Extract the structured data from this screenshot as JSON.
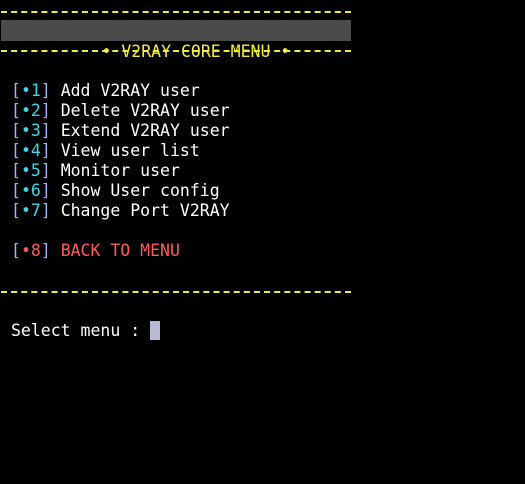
{
  "header": {
    "title": "• V2RAY CORE MENU •"
  },
  "menu": {
    "items": [
      {
        "number": "•1",
        "label": "Add V2RAY user"
      },
      {
        "number": "•2",
        "label": "Delete V2RAY user"
      },
      {
        "number": "•3",
        "label": "Extend V2RAY user"
      },
      {
        "number": "•4",
        "label": "View user list"
      },
      {
        "number": "•5",
        "label": "Monitor user"
      },
      {
        "number": "•6",
        "label": "Show User config"
      },
      {
        "number": "•7",
        "label": "Change Port V2RAY"
      }
    ],
    "back": {
      "number": "•8",
      "label": "BACK TO MENU"
    }
  },
  "prompt": {
    "text": "Select menu : "
  },
  "colors": {
    "background": "#000000",
    "rule": "#f2ea3c",
    "header_bg": "#4a4a4a",
    "header_text": "#f2ea3c",
    "bracket": "#9fb0ff",
    "number": "#3fd6e6",
    "back": "#ff5a5a",
    "text": "#ffffff",
    "cursor": "#b9b9d3"
  }
}
